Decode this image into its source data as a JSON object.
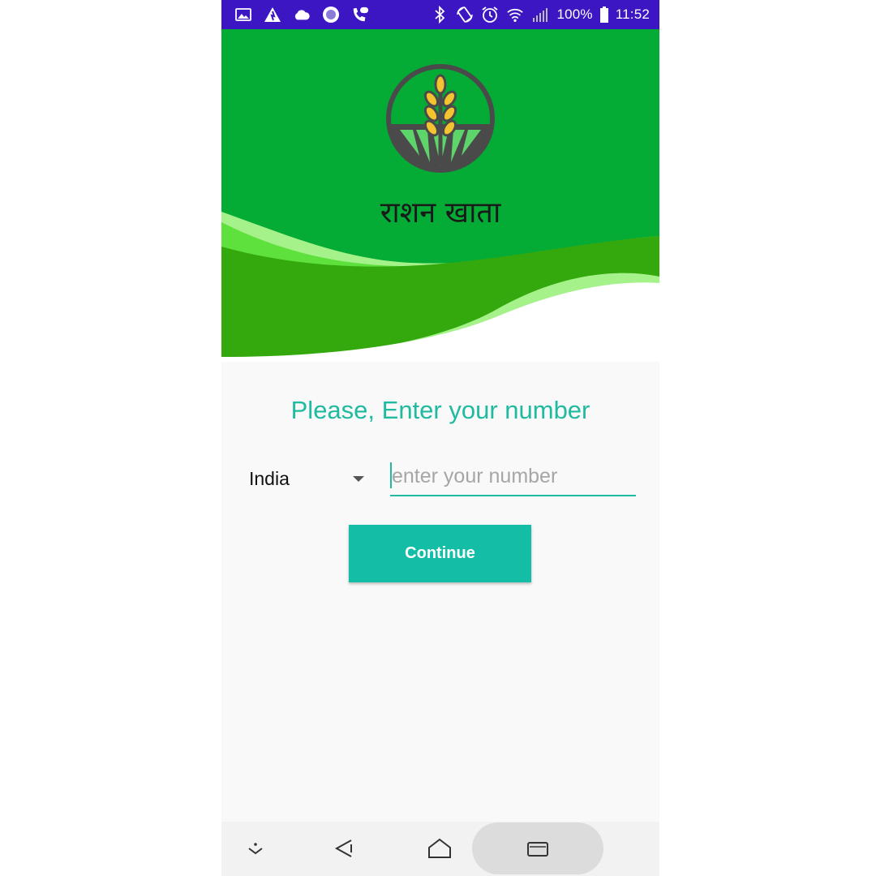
{
  "status_bar": {
    "battery": "100%",
    "time": "11:52",
    "icons": [
      "gallery-icon",
      "warning-triangle-icon",
      "cloud-icon",
      "circle-record-icon",
      "wifi-calling-icon",
      "bluetooth-icon",
      "rotate-icon",
      "alarm-icon",
      "wifi-icon",
      "signal-icon",
      "battery-icon"
    ]
  },
  "header": {
    "app_title": "राशन खाता",
    "logo": "wheat-field-logo",
    "colors": {
      "top": "#04ab35",
      "wave_light": "#a6f28a",
      "wave_mid": "#5ee13c",
      "wave_dark": "#34a90e"
    }
  },
  "form": {
    "prompt": "Please, Enter your number",
    "country": "India",
    "number_placeholder": "enter your number",
    "continue_label": "Continue",
    "accent_color": "#14bea6"
  },
  "nav_bar": {
    "buttons": [
      "hide-keyboard-icon",
      "back-icon",
      "home-icon",
      "recent-apps-icon"
    ]
  }
}
